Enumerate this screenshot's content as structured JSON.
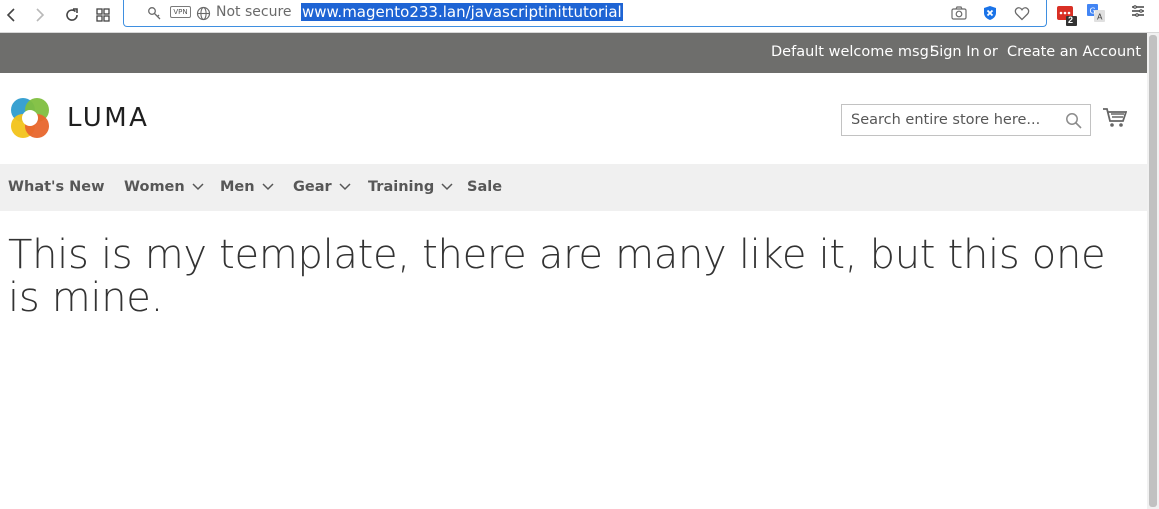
{
  "browser": {
    "security_label": "Not secure",
    "vpn_label": "VPN",
    "url": "www.magento233.lan/javascriptinittutorial",
    "extension_badge": "2",
    "icons": [
      "back-icon",
      "forward-icon",
      "reload-icon",
      "tabs-grid-icon",
      "key-icon",
      "globe-icon",
      "camera-icon",
      "adblock-shield-icon",
      "heart-icon",
      "extension-icon",
      "translate-icon",
      "menu-icon"
    ]
  },
  "header": {
    "welcome": "Default welcome msg!",
    "sign_in": "Sign In",
    "or": "or",
    "create_account": "Create an Account"
  },
  "logo": {
    "text": "LUMA"
  },
  "search": {
    "placeholder": "Search entire store here..."
  },
  "nav": {
    "items": [
      {
        "label": "What's New",
        "has_caret": false
      },
      {
        "label": "Women",
        "has_caret": true
      },
      {
        "label": "Men",
        "has_caret": true
      },
      {
        "label": "Gear",
        "has_caret": true
      },
      {
        "label": "Training",
        "has_caret": true
      },
      {
        "label": "Sale",
        "has_caret": false
      }
    ]
  },
  "main": {
    "title": "This is my template, there are many like it, but this one is mine."
  },
  "colors": {
    "header_bar": "#6e6e6c",
    "nav_bar": "#f0f0f0",
    "url_highlight": "#1e64d4",
    "address_border": "#3f8fe0"
  }
}
